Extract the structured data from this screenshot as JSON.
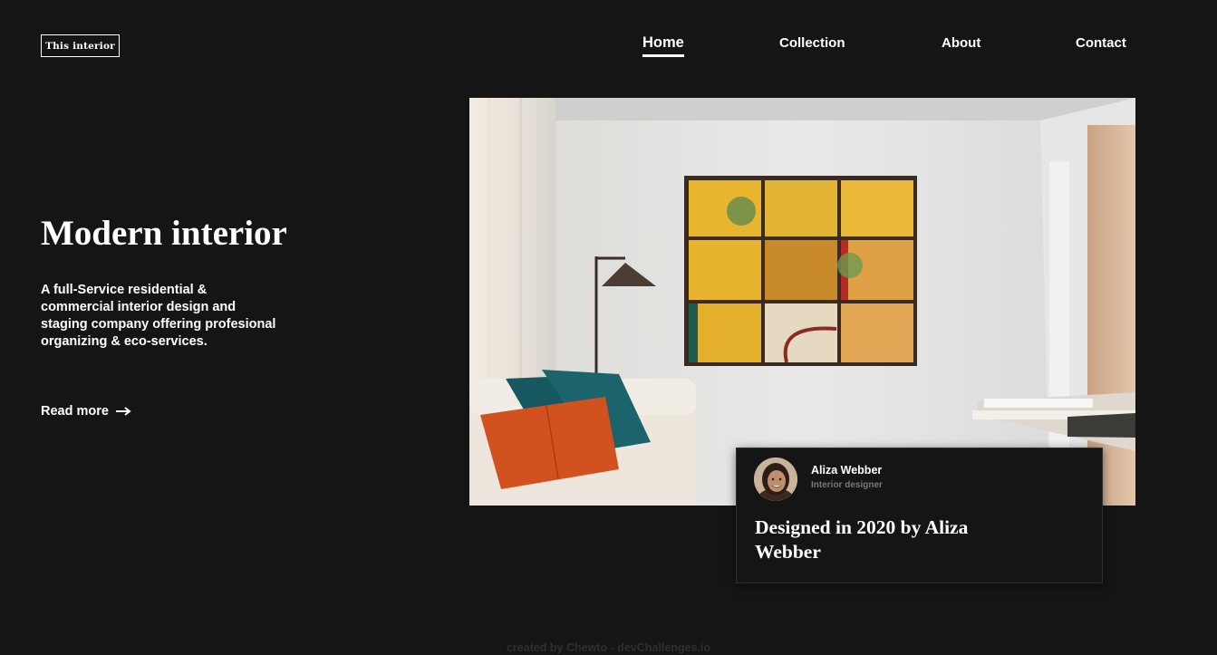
{
  "header": {
    "logo": "This interior",
    "nav": [
      {
        "label": "Home",
        "active": true
      },
      {
        "label": "Collection",
        "active": false
      },
      {
        "label": "About",
        "active": false
      },
      {
        "label": "Contact",
        "active": false
      }
    ]
  },
  "hero": {
    "title": "Modern interior",
    "description": "A full-Service residential & commercial interior design and staging company offering profesional organizing & eco-services.",
    "read_more": "Read more",
    "read_more_icon": "arrow-right-icon"
  },
  "feature": {
    "image_alt": "Living room with yellow window art, lamp and sofa",
    "author": {
      "name": "Aliza Webber",
      "role": "Interior designer",
      "avatar_icon": "avatar"
    },
    "caption": "Designed in 2020 by Aliza Webber"
  },
  "footer": {
    "credit": "created by Chewto - devChallenges.io"
  },
  "colors": {
    "background": "#151515",
    "text": "#ffffff",
    "muted": "#777777",
    "accent_yellow": "#e8b52f",
    "accent_orange": "#d2521f",
    "accent_teal": "#17575f"
  }
}
